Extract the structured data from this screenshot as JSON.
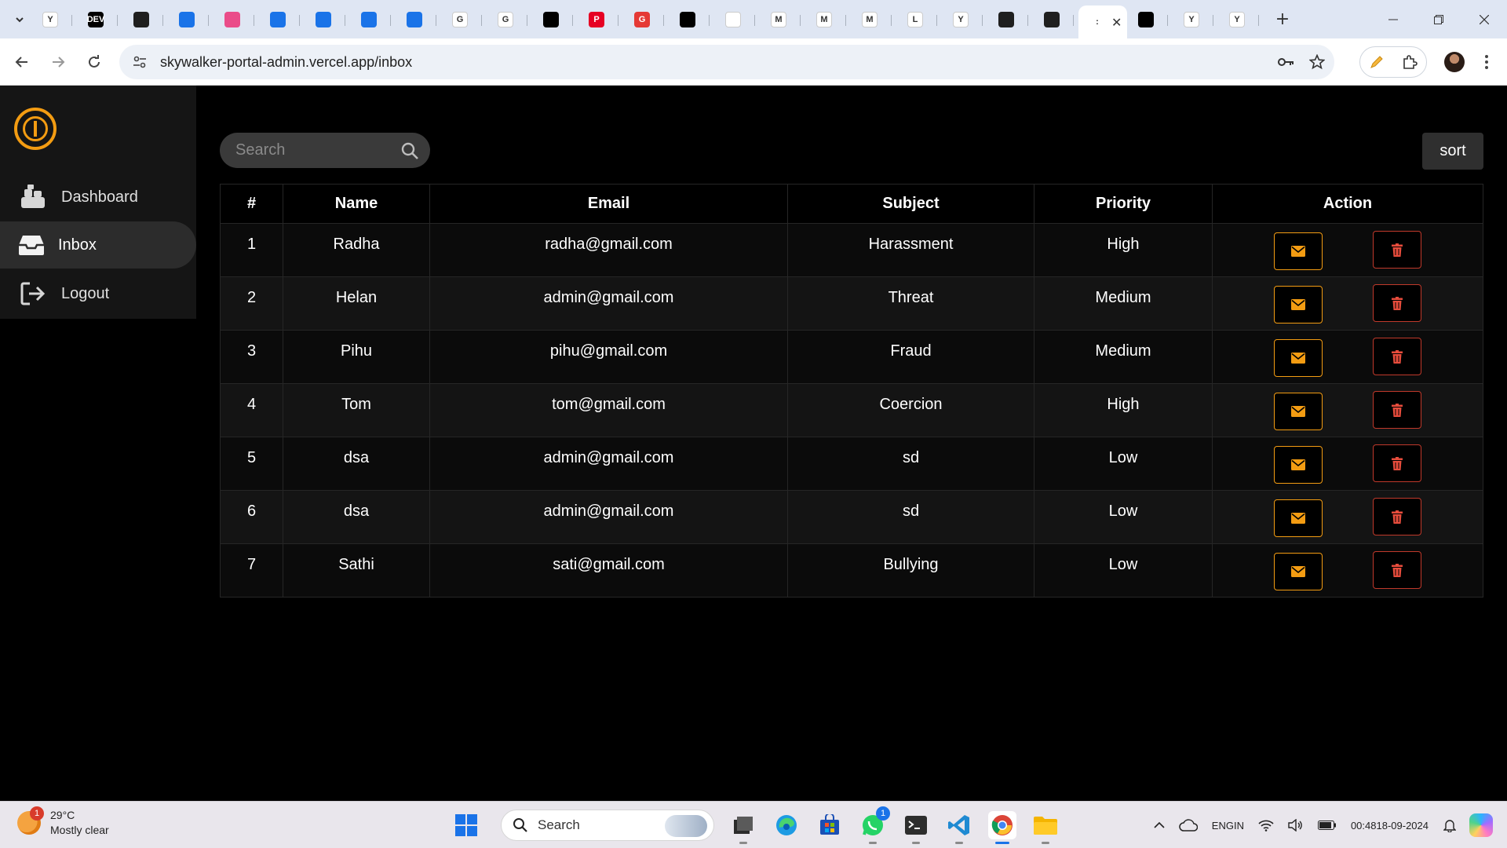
{
  "browser": {
    "tabs": [
      {
        "icon": "ycombinator-icon",
        "label": "Y",
        "color": "#ffffff"
      },
      {
        "icon": "dev-icon",
        "label": "DEV",
        "color": "#000000"
      },
      {
        "icon": "github-icon",
        "label": "",
        "color": "#1f1f1f"
      },
      {
        "icon": "download-icon",
        "label": "",
        "color": "#1a73e8"
      },
      {
        "icon": "dribbble-icon",
        "label": "",
        "color": "#ea4c89"
      },
      {
        "icon": "codeium-icon",
        "label": "",
        "color": "#1a73e8"
      },
      {
        "icon": "codeium-icon",
        "label": "",
        "color": "#1a73e8"
      },
      {
        "icon": "codeium-icon",
        "label": "",
        "color": "#1a73e8"
      },
      {
        "icon": "flag-icon",
        "label": "",
        "color": "#1a73e8"
      },
      {
        "icon": "google-icon",
        "label": "G",
        "color": "#ffffff"
      },
      {
        "icon": "google-icon",
        "label": "G",
        "color": "#ffffff"
      },
      {
        "icon": "notion-icon",
        "label": "",
        "color": "#000000"
      },
      {
        "icon": "pinterest-icon",
        "label": "P",
        "color": "#e60023"
      },
      {
        "icon": "gdocs-red-icon",
        "label": "G",
        "color": "#e53935"
      },
      {
        "icon": "openai-icon",
        "label": "",
        "color": "#000000"
      },
      {
        "icon": "openai-icon",
        "label": "",
        "color": "#ffffff"
      },
      {
        "icon": "gmail-icon",
        "label": "M",
        "color": "#ffffff"
      },
      {
        "icon": "gmail-icon",
        "label": "M",
        "color": "#ffffff"
      },
      {
        "icon": "gmail-icon",
        "label": "M",
        "color": "#ffffff"
      },
      {
        "icon": "l-icon",
        "label": "L",
        "color": "#ffffff"
      },
      {
        "icon": "ycombinator-icon",
        "label": "Y",
        "color": "#ffffff"
      },
      {
        "icon": "github-icon",
        "label": "",
        "color": "#1f1f1f"
      },
      {
        "icon": "github-icon",
        "label": "",
        "color": "#1f1f1f"
      }
    ],
    "active_tab": {
      "icon": "jedi-icon",
      "close_label": "✕"
    },
    "tabs_after": [
      {
        "icon": "puzzle-black-icon",
        "label": "",
        "color": "#000000"
      },
      {
        "icon": "ycombinator-icon",
        "label": "Y",
        "color": "#ffffff"
      },
      {
        "icon": "ycombinator-icon",
        "label": "Y",
        "color": "#ffffff"
      }
    ],
    "new_tab_label": "+",
    "url": "skywalker-portal-admin.vercel.app/inbox"
  },
  "app": {
    "sidebar": {
      "items": [
        {
          "label": "Dashboard",
          "icon": "dashboard-icon"
        },
        {
          "label": "Inbox",
          "icon": "inbox-icon",
          "active": true
        },
        {
          "label": "Logout",
          "icon": "logout-icon"
        }
      ]
    },
    "search": {
      "placeholder": "Search"
    },
    "sort_label": "sort",
    "table": {
      "headers": [
        "#",
        "Name",
        "Email",
        "Subject",
        "Priority",
        "Action"
      ],
      "rows": [
        {
          "num": "1",
          "name": "Radha",
          "email": "radha@gmail.com",
          "subject": "Harassment",
          "priority": "High"
        },
        {
          "num": "2",
          "name": "Helan",
          "email": "admin@gmail.com",
          "subject": "Threat",
          "priority": "Medium"
        },
        {
          "num": "3",
          "name": "Pihu",
          "email": "pihu@gmail.com",
          "subject": "Fraud",
          "priority": "Medium"
        },
        {
          "num": "4",
          "name": "Tom",
          "email": "tom@gmail.com",
          "subject": "Coercion",
          "priority": "High"
        },
        {
          "num": "5",
          "name": "dsa",
          "email": "admin@gmail.com",
          "subject": "sd",
          "priority": "Low"
        },
        {
          "num": "6",
          "name": "dsa",
          "email": "admin@gmail.com",
          "subject": "sd",
          "priority": "Low"
        },
        {
          "num": "7",
          "name": "Sathi",
          "email": "sati@gmail.com",
          "subject": "Bullying",
          "priority": "Low"
        }
      ]
    },
    "colors": {
      "accent": "#f39c12",
      "danger": "#c0392b",
      "background": "#000000",
      "sidebar": "#151515"
    }
  },
  "taskbar": {
    "weather": {
      "temp": "29°C",
      "condition": "Mostly clear",
      "badge": "1"
    },
    "search_label": "Search",
    "apps": [
      "file-explorer-icon",
      "edge-icon",
      "store-icon",
      "whatsapp-icon",
      "terminal-icon",
      "vscode-icon",
      "chrome-icon",
      "folder-icon"
    ],
    "whatsapp_badge": "1",
    "lang_line1": "ENG",
    "lang_line2": "IN",
    "time": "00:48",
    "date": "18-09-2024"
  }
}
